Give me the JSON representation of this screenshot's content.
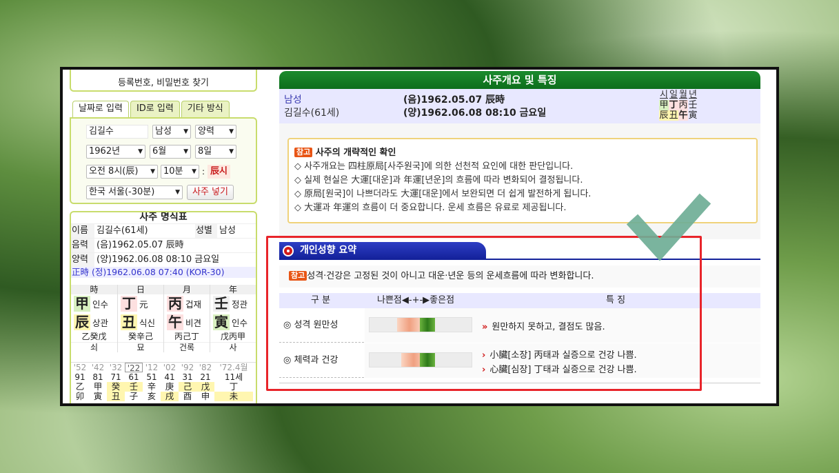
{
  "find_link": "등록번호, 비밀번호 찾기",
  "input_tabs": [
    "날짜로 입력",
    "ID로 입력",
    "기타 방식"
  ],
  "input": {
    "name": "김길수",
    "gender": "남성",
    "calendar": "양력",
    "year": "1962년",
    "month": "6월",
    "day": "8일",
    "hour": "오전 8시(辰)",
    "minute": "10분",
    "colon": ":",
    "jinsi": "辰시",
    "region": "한국 서울(-30분)",
    "submit": "사주 넣기"
  },
  "myeongsik": {
    "title": "사주 명식표",
    "name_label": "이름",
    "name_value": "김길수(61세)",
    "gender_label": "성별",
    "gender_value": "남성",
    "um_label": "음력",
    "um_value": "(음)1962.05.07 辰時",
    "yang_label": "양력",
    "yang_value": "(양)1962.06.08 08:10 금요일",
    "jeongsi": "正時 (정)1962.06.08 07:40 (KOR-30)",
    "pillars": [
      {
        "head": "時",
        "top": "甲",
        "top_tag": "인수",
        "bottom": "辰",
        "bottom_tag": "상관",
        "hidden": "乙癸戊",
        "status": "쇠"
      },
      {
        "head": "日",
        "top": "丁",
        "top_tag": "元",
        "bottom": "丑",
        "bottom_tag": "식신",
        "hidden": "癸辛己",
        "status": "묘"
      },
      {
        "head": "月",
        "top": "丙",
        "top_tag": "겁재",
        "bottom": "午",
        "bottom_tag": "비견",
        "hidden": "丙己丁",
        "status": "건록"
      },
      {
        "head": "年",
        "top": "壬",
        "top_tag": "정관",
        "bottom": "寅",
        "bottom_tag": "인수",
        "hidden": "戊丙甲",
        "status": "사"
      }
    ],
    "daeun_years": [
      "'52",
      "'42",
      "'32",
      "'22",
      "'12",
      "'02",
      "'92",
      "'82",
      "'72.4월"
    ],
    "daeun_ages": [
      "91",
      "81",
      "71",
      "61",
      "51",
      "41",
      "31",
      "21",
      "11세"
    ],
    "daeun_stems": [
      "乙",
      "甲",
      "癸",
      "壬",
      "辛",
      "庚",
      "己",
      "戊",
      "丁"
    ],
    "daeun_branches": [
      "卯",
      "寅",
      "丑",
      "子",
      "亥",
      "戌",
      "酉",
      "申",
      "未"
    ]
  },
  "right": {
    "title": "사주개요 및 특징",
    "gender": "남성",
    "full_name": "김길수(61세)",
    "um": "(음)1962.05.07 辰時",
    "yang": "(양)1962.06.08 08:10 금요일",
    "mini_heads": [
      "시",
      "일",
      "월",
      "년"
    ],
    "mini_stems": [
      "甲",
      "丁",
      "丙",
      "壬"
    ],
    "mini_branches": [
      "辰",
      "丑",
      "午",
      "寅"
    ],
    "notice_badge": "참고",
    "notice_title": "사주의 개략적인 확인",
    "notice_lines": [
      "◇ 사주개요는 四柱原局[사주원국]에 의한 선천적 요인에 대한 판단입니다.",
      "◇ 실제 현실은 大運[대운]과 年運[년운]의 흐름에 따라 변화되어 결정됩니다.",
      "◇ 原局[원국]이 나쁘더라도 大運[대운]에서 보완되면 더 쉽게 발전하게 됩니다.",
      "◇ 大運과 年運의 흐름이 더 중요합니다. 운세 흐름은 유료로 제공됩니다."
    ],
    "section_title": "개인성향 요약",
    "section_note": "성격·건강은 고정된 것이 아니고 대운·년운 등의 운세흐름에 따라 변화합니다.",
    "th_category": "구 분",
    "th_scale": "나쁜점◀-+-▶좋은점",
    "th_feature": "특 징",
    "rows": [
      {
        "label": "◎ 성격 원만성",
        "orange": 0.27,
        "green": 0.49,
        "features": [
          "원만하지 못하고, 결점도 많음."
        ]
      },
      {
        "label": "◎ 체력과 건강",
        "orange": 0.31,
        "green": 0.49,
        "features": [
          "小臟[소장] 丙태과 실증으로 건강 나쁨.",
          "心臟[심장] 丁태과 실증으로 건강 나쁨."
        ]
      }
    ]
  }
}
